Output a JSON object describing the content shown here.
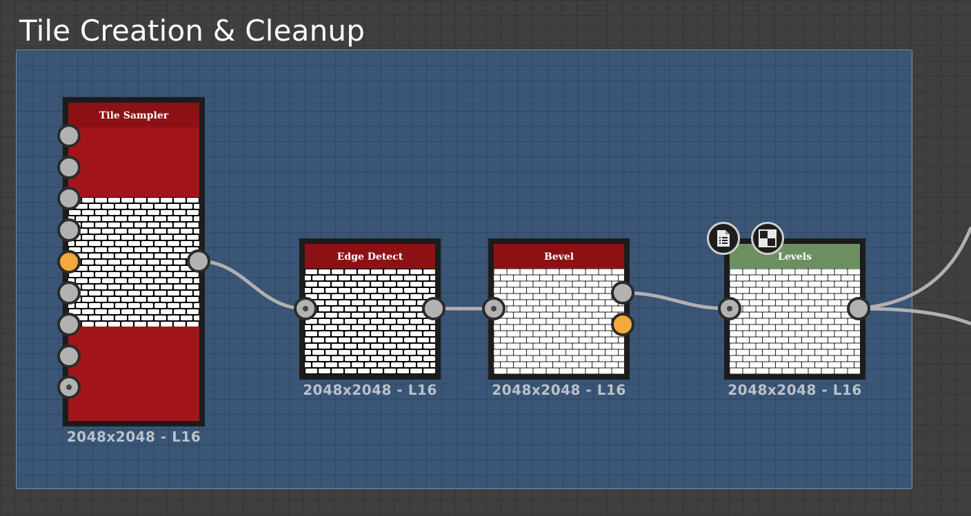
{
  "frame": {
    "title": "Tile Creation & Cleanup"
  },
  "nodes": [
    {
      "id": "tile-sampler",
      "title": "Tile Sampler",
      "resolution": "2048x2048 - L16",
      "title_color": "#8c1114",
      "body_color": "#a2161b"
    },
    {
      "id": "edge-detect",
      "title": "Edge Detect",
      "resolution": "2048x2048 - L16",
      "title_color": "#8c1114"
    },
    {
      "id": "bevel",
      "title": "Bevel",
      "resolution": "2048x2048 - L16",
      "title_color": "#8c1114"
    },
    {
      "id": "levels",
      "title": "Levels",
      "resolution": "2048x2048 - L16",
      "title_color": "#6c8f62"
    }
  ],
  "icons": {
    "levels_badges": [
      "document-list-icon",
      "checker-icon"
    ]
  },
  "colors": {
    "wire": "#b0b0b0",
    "port": "#b2b2b2",
    "port_active": "#f5a93a",
    "frame_fill": "#3a5575"
  }
}
